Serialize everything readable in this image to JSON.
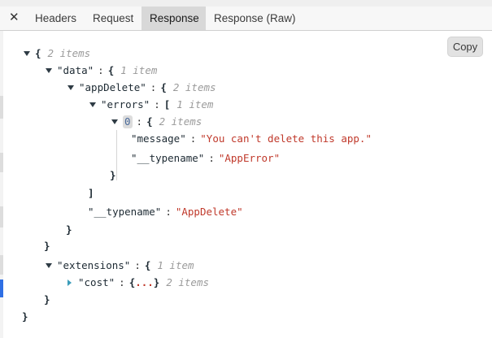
{
  "tabs": {
    "close_glyph": "✕",
    "items": [
      {
        "label": "Headers",
        "active": false
      },
      {
        "label": "Request",
        "active": false
      },
      {
        "label": "Response",
        "active": true
      },
      {
        "label": "Response (Raw)",
        "active": false
      }
    ]
  },
  "toolbar": {
    "copy_label": "Copy"
  },
  "json_tree": {
    "root_count": "2 items",
    "data_key": "\"data\"",
    "data_count": "1 item",
    "appdelete_key": "\"appDelete\"",
    "appdelete_count": "2 items",
    "errors_key": "\"errors\"",
    "errors_count": "1 item",
    "error0_index": "0",
    "error0_count": "2 items",
    "message_key": "\"message\"",
    "message_value": "\"You can't delete this app.\"",
    "typename_key": "\"__typename\"",
    "error_typename_value": "\"AppError\"",
    "appdelete_typename_value": "\"AppDelete\"",
    "extensions_key": "\"extensions\"",
    "extensions_count": "1 item",
    "cost_key": "\"cost\"",
    "cost_ellipsis": "...",
    "cost_count": "2 items"
  },
  "colors": {
    "string_value": "#c0392b",
    "item_count": "#9a9a9a",
    "active_tab_bg": "#d8d8d8",
    "gutter_active": "#2f6fe4"
  },
  "icons": {
    "close": "close-icon",
    "expanded": "triangle-down-icon",
    "collapsed": "triangle-right-icon"
  }
}
